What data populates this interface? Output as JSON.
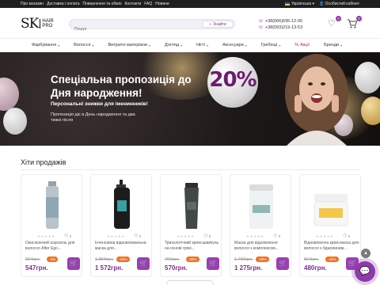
{
  "topbar": {
    "links": [
      "Про магазин",
      "Доставка і оплата",
      "Повернення та обмін",
      "Контакти",
      "FAQ",
      "Новини"
    ],
    "language": "Українська",
    "account": "Особистий кабінет"
  },
  "header": {
    "logo_sk": "SK",
    "logo_hair": "HAIR",
    "logo_pro": "PRO",
    "search_placeholder": "Пошук",
    "search_button": "Знайти",
    "phones": [
      "+38(066)695-12-95",
      "+38(093)219-13-53"
    ],
    "wishlist_count": "0",
    "cart_count": "0"
  },
  "nav": {
    "items": [
      "Фарбування",
      "Волосся",
      "Витратні матеріали",
      "Догляд",
      "Нігті",
      "Аксесуари",
      "Гребінці",
      "Акції",
      "Бренди"
    ]
  },
  "banner": {
    "headline": "Спеціальна пропозиція до Дня народження!",
    "subheadline": "Персональні знижки для іменинників!",
    "note": "Пропозиція діє в День народження та два тижні після",
    "badge": "20%"
  },
  "section": {
    "title": "Хіти продажів"
  },
  "products": [
    {
      "name": "Окислюючий аэрозоль для волосся After Ego...",
      "reviews": "0",
      "old_price": "564грн.",
      "discount": "-3%",
      "price": "547грн."
    },
    {
      "name": "Інтенсивна відновлювальна маска для...",
      "reviews": "0",
      "old_price": "1 869грн.",
      "discount": "-16%",
      "price": "1 572грн."
    },
    {
      "name": "Трихологічний крем-шампунь на основі грязі...",
      "reviews": "0",
      "old_price": "760грн.",
      "discount": "-25%",
      "price": "570грн."
    },
    {
      "name": "Маска для відновлення волосся з комплексом...",
      "reviews": "0",
      "old_price": "1 790грн.",
      "discount": "-29%",
      "price": "1 275грн."
    },
    {
      "name": "Відновлююча крем-маска для волосся з бджолиним...",
      "reviews": "0",
      "old_price": "564грн.",
      "discount": "-15%",
      "price": "480грн."
    }
  ],
  "colors": {
    "accent": "#8e3aa8",
    "price": "#7b2d8f",
    "discount": "#f2711c",
    "topbar": "#1f1f1f"
  }
}
